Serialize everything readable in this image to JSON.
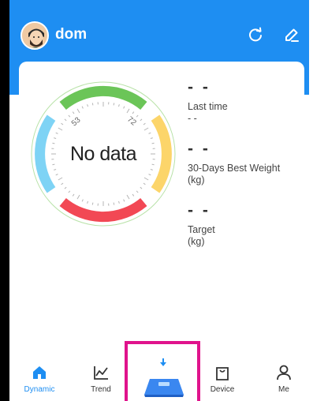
{
  "header": {
    "username": "dom",
    "avatar_icon": "user-avatar",
    "sync_icon": "refresh-icon",
    "edit_icon": "edit-icon",
    "background_color": "#1e8ef2"
  },
  "gauge": {
    "status_text": "No data",
    "tick_label_left": "53",
    "tick_label_right": "72",
    "segment_colors": [
      "#6bc558",
      "#fcd56a",
      "#f24854",
      "#7ed3f5"
    ]
  },
  "stats": [
    {
      "value": "- -",
      "label": "Last time",
      "sub": "- -"
    },
    {
      "value": "- -",
      "label": "30-Days Best Weight",
      "sub": "(kg)"
    },
    {
      "value": "- -",
      "label": "Target",
      "sub": "(kg)"
    }
  ],
  "nav": {
    "dynamic": "Dynamic",
    "trend": "Trend",
    "device": "Device",
    "me": "Me",
    "weigh_icon": "scale-icon",
    "highlight_color": "#e0138c",
    "active_color": "#1e8ef2"
  }
}
